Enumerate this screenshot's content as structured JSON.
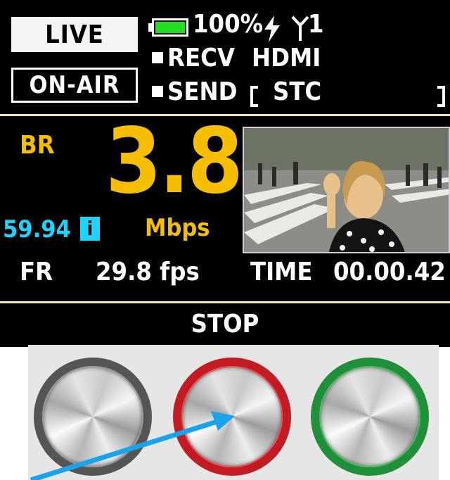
{
  "status": {
    "live_label": "LIVE",
    "onair_label": "ON-AIR",
    "battery_level": 1.0,
    "battery_text": "100%",
    "antenna_text": "1",
    "recv_label": "RECV",
    "input_label": "HDMI",
    "send_label": "SEND",
    "stc_label": "STC"
  },
  "bitrate": {
    "label": "BR",
    "value": "3.8",
    "unit": "Mbps",
    "frame_mode": "59.94",
    "scan_indicator": "i"
  },
  "stats": {
    "fr_label": "FR",
    "fr_value": "29.8 fps",
    "time_label": "TIME",
    "time_value": "00.00.42"
  },
  "footer": {
    "state_label": "STOP"
  },
  "colors": {
    "accent_yellow": "#f5bf00",
    "accent_cyan": "#1fd3ff",
    "battery_green": "#22dd22",
    "ring_gray": "#555555",
    "ring_red": "#c21b22",
    "ring_green": "#1f8f3a",
    "arrow_blue": "#1aa3e8"
  },
  "icons": {
    "battery": "battery-icon",
    "power": "lightning-icon",
    "antenna": "antenna-icon"
  }
}
